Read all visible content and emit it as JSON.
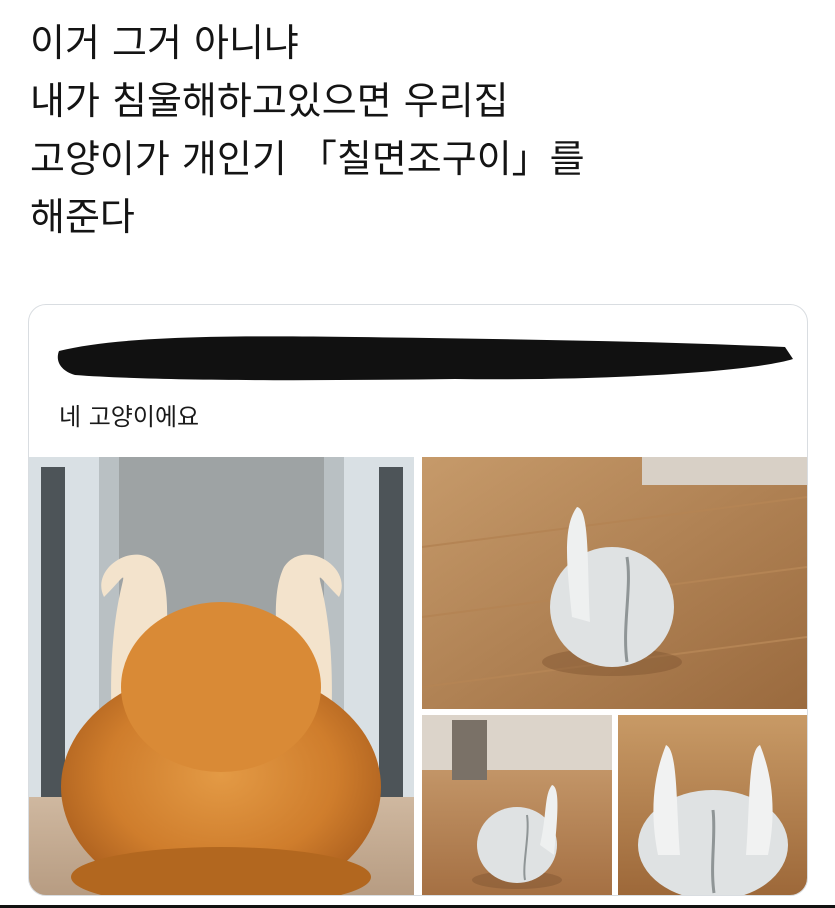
{
  "post": {
    "lines": [
      "이거 그거 아니냐",
      "내가 침울해하고있으면 우리집",
      "고양이가 개인기 「칠면조구이」를",
      "해준다"
    ]
  },
  "quoted_tweet": {
    "text": "네 고양이에요"
  },
  "images": [
    {
      "name": "orange-cat-turkey-pose-photo"
    },
    {
      "name": "white-cat-one-leg-up-photo"
    },
    {
      "name": "white-cat-small-floor-photo"
    },
    {
      "name": "white-cat-both-legs-up-photo"
    }
  ],
  "colors": {
    "background": "#ffffff",
    "card_border": "#d9dde1",
    "redaction": "#111111"
  }
}
